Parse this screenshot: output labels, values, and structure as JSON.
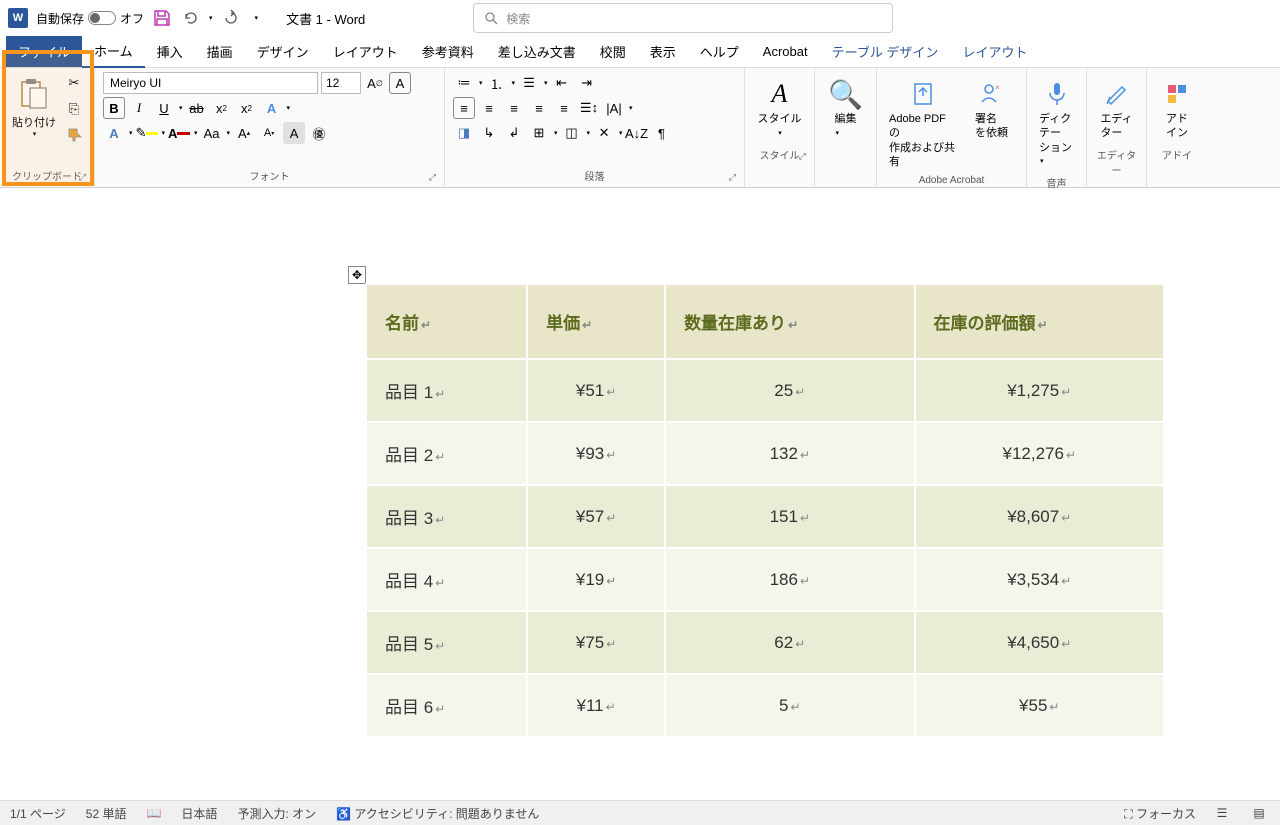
{
  "title_bar": {
    "autosave_label": "自動保存",
    "autosave_state": "オフ",
    "doc_title": "文書 1  -  Word",
    "search_placeholder": "検索"
  },
  "tabs": {
    "file": "ファイル",
    "home": "ホーム",
    "insert": "挿入",
    "draw": "描画",
    "design": "デザイン",
    "layout": "レイアウト",
    "references": "参考資料",
    "mailings": "差し込み文書",
    "review": "校閲",
    "view": "表示",
    "help": "ヘルプ",
    "acrobat": "Acrobat",
    "table_design": "テーブル デザイン",
    "table_layout": "レイアウト"
  },
  "ribbon": {
    "clipboard": {
      "paste": "貼り付け",
      "label": "クリップボード"
    },
    "font": {
      "name": "Meiryo UI",
      "size": "12",
      "label": "フォント"
    },
    "paragraph": {
      "label": "段落"
    },
    "styles": {
      "btn": "スタイル",
      "label": "スタイル"
    },
    "editing": {
      "btn": "編集"
    },
    "acrobat": {
      "pdf1": "Adobe PDF の",
      "pdf2": "作成および共有",
      "sign1": "署名",
      "sign2": "を依頼",
      "label": "Adobe Acrobat"
    },
    "voice": {
      "btn1": "ディクテー",
      "btn2": "ション",
      "label": "音声"
    },
    "editor": {
      "btn1": "エディ",
      "btn2": "ター",
      "label": "エディター"
    },
    "addins": {
      "btn1": "アド",
      "btn2": "イン",
      "label": "アドイ"
    }
  },
  "table": {
    "headers": [
      "名前",
      "単価",
      "数量在庫あり",
      "在庫の評価額"
    ],
    "rows": [
      [
        "品目 1",
        "¥51",
        "25",
        "¥1,275"
      ],
      [
        "品目 2",
        "¥93",
        "132",
        "¥12,276"
      ],
      [
        "品目 3",
        "¥57",
        "151",
        "¥8,607"
      ],
      [
        "品目 4",
        "¥19",
        "186",
        "¥3,534"
      ],
      [
        "品目 5",
        "¥75",
        "62",
        "¥4,650"
      ],
      [
        "品目 6",
        "¥11",
        "5",
        "¥55"
      ]
    ]
  },
  "status": {
    "page": "1/1 ページ",
    "words": "52 単語",
    "lang": "日本語",
    "predict": "予測入力: オン",
    "a11y": "アクセシビリティ: 問題ありません",
    "focus": "フォーカス"
  }
}
